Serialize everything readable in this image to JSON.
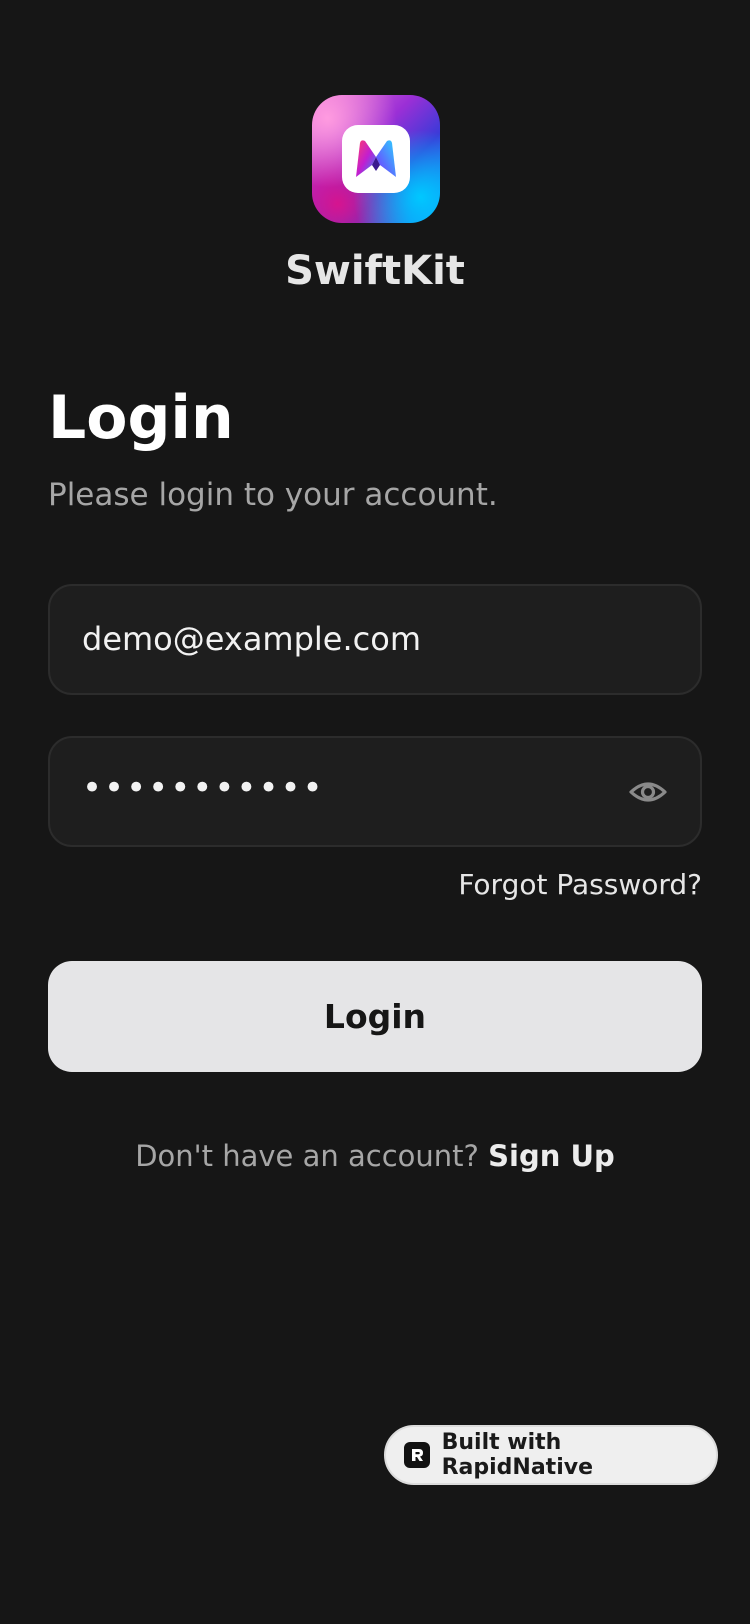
{
  "app": {
    "name": "SwiftKit",
    "logo_icon": "swiftkit-m-logo"
  },
  "login": {
    "title": "Login",
    "subtitle": "Please login to your account.",
    "email_value": "demo@example.com",
    "password_mask": "•••••••••••",
    "password_toggle_icon": "eye-icon",
    "forgot_label": "Forgot Password?",
    "button_label": "Login",
    "signup_prompt": "Don't have an account? ",
    "signup_link": "Sign Up"
  },
  "badge": {
    "label": "Built with RapidNative",
    "icon": "rapidnative-icon"
  },
  "colors": {
    "background": "#161616",
    "field_bg": "#1e1e1e",
    "button_bg": "#e5e5e7",
    "muted_text": "#a6a6a6"
  }
}
